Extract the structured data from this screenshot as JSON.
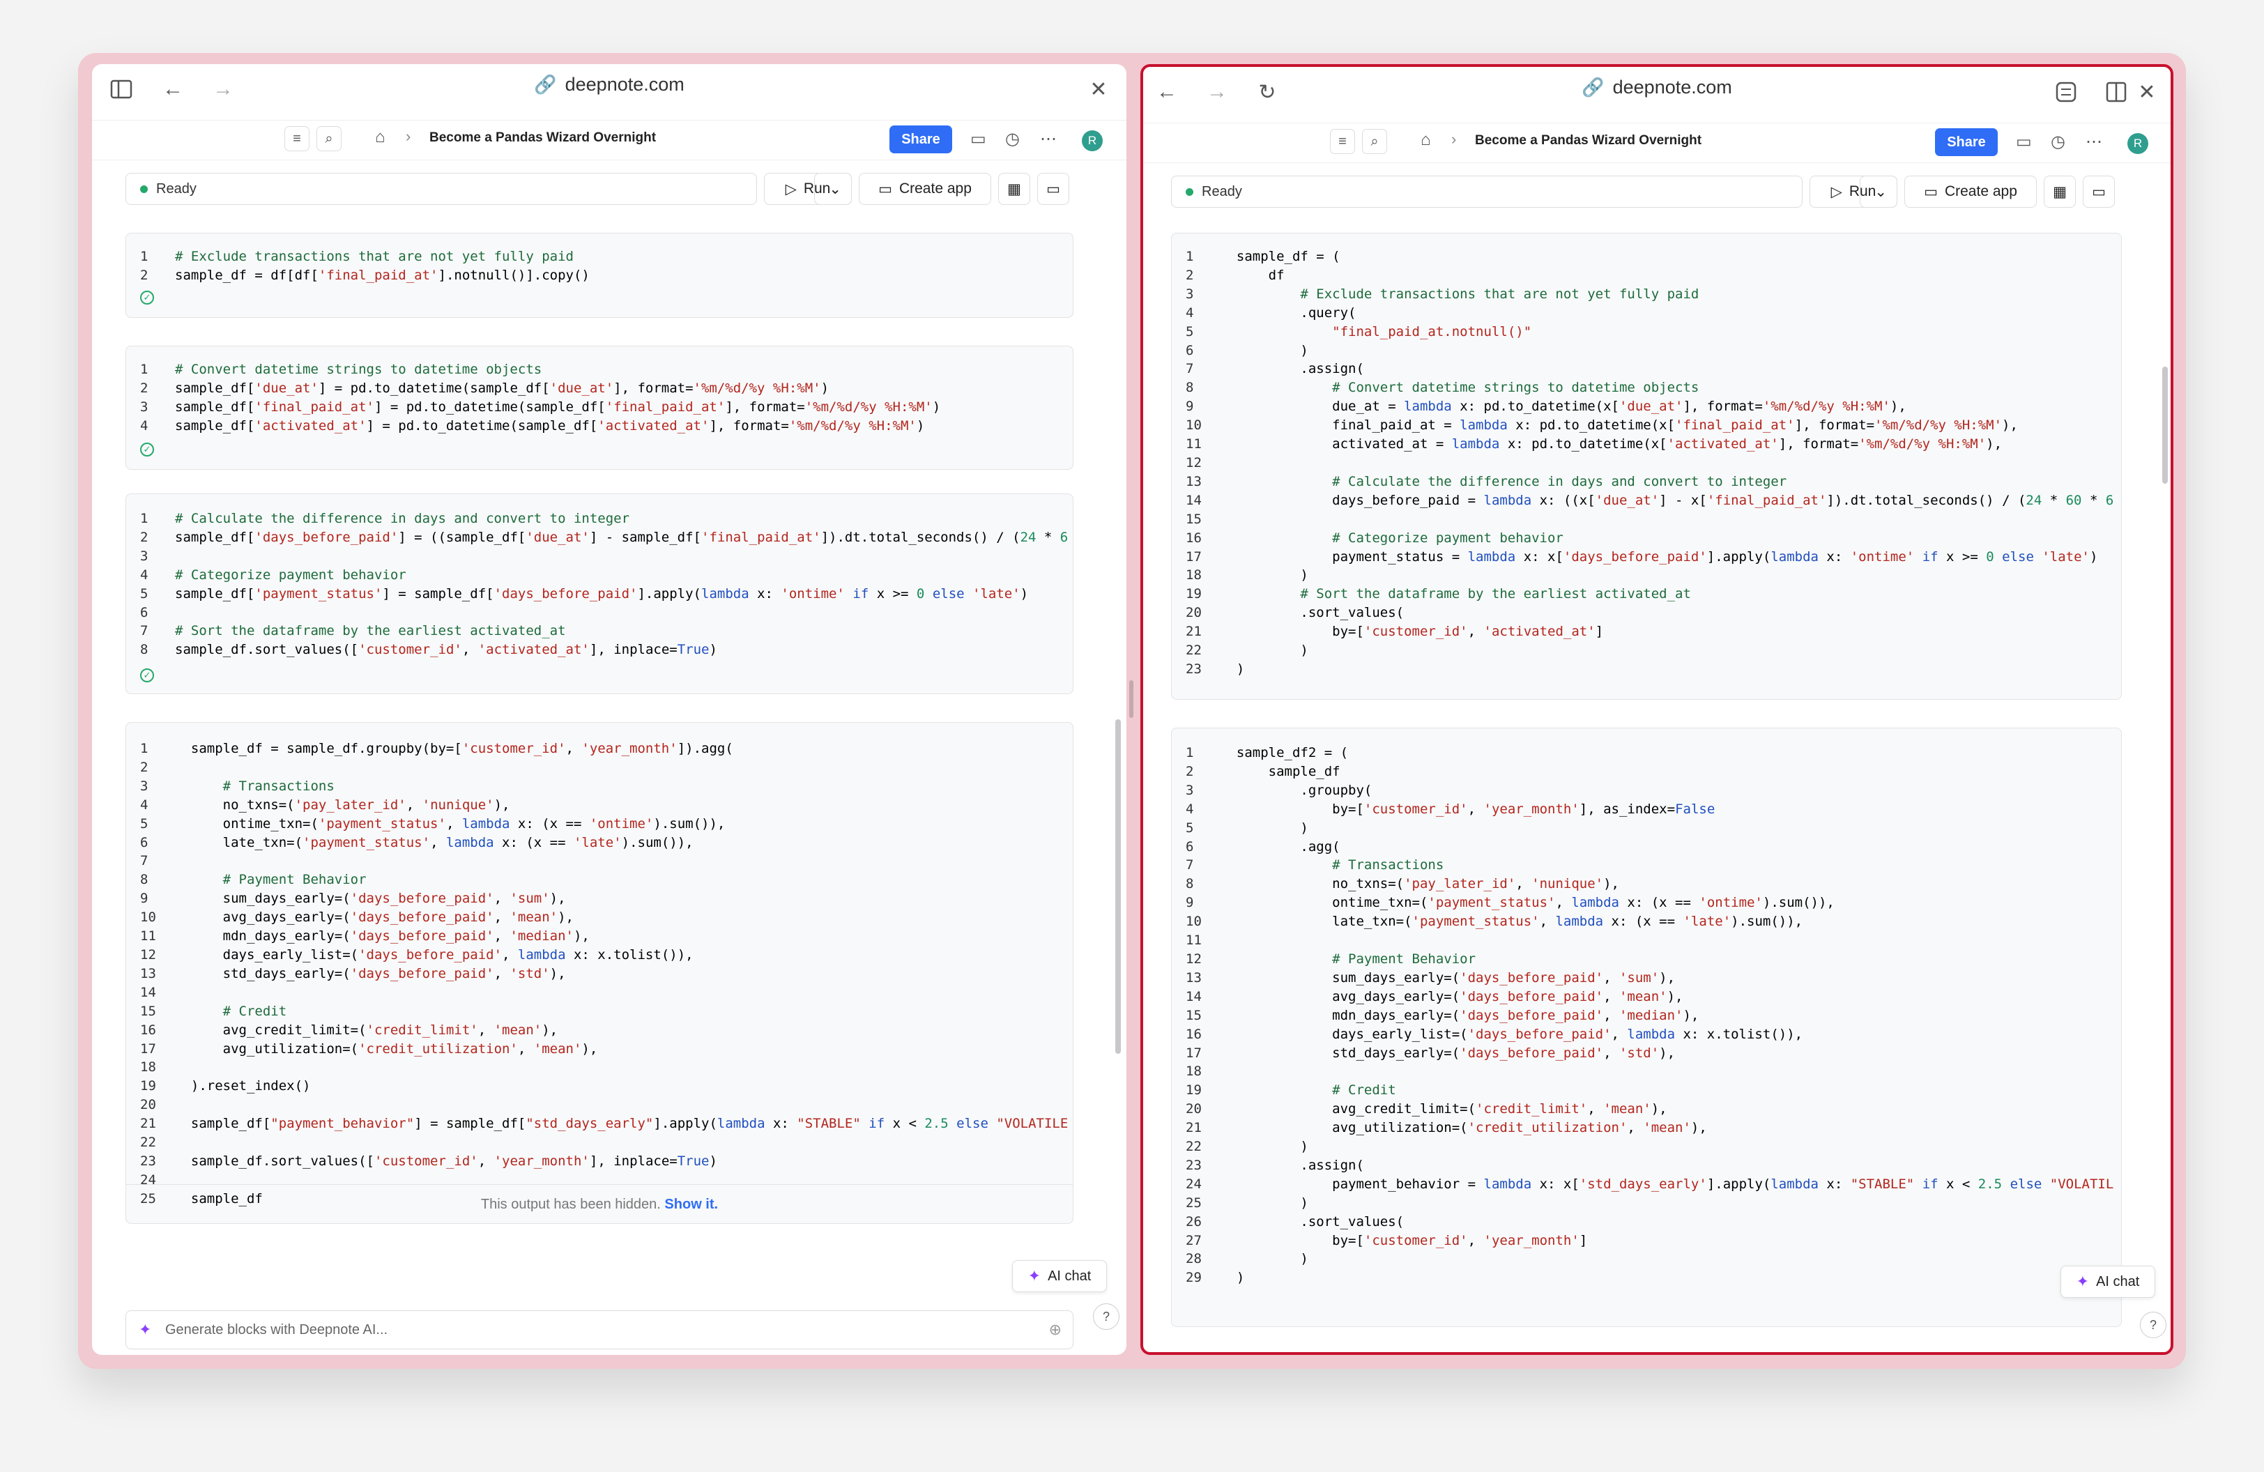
{
  "browser": {
    "url": "deepnote.com"
  },
  "notebook": {
    "title": "Become a Pandas Wizard Overnight",
    "share_label": "Share",
    "status": "Ready",
    "run_label": "Run",
    "create_app_label": "Create app",
    "avatar_initial": "R",
    "ai_chat_label": "AI chat",
    "generate_placeholder": "Generate blocks with Deepnote AI...",
    "hidden_output_text": "This output has been hidden.",
    "show_it_label": "Show it."
  },
  "colors": {
    "accent": "#2f6df6",
    "active_pane_border": "#c8102e",
    "success": "#25a86b"
  },
  "left_cells": [
    [
      "# Exclude transactions that are not yet fully paid",
      "sample_df = df[df['final_paid_at'].notnull()].copy()"
    ],
    [
      "# Convert datetime strings to datetime objects",
      "sample_df['due_at'] = pd.to_datetime(sample_df['due_at'], format='%m/%d/%y %H:%M')",
      "sample_df['final_paid_at'] = pd.to_datetime(sample_df['final_paid_at'], format='%m/%d/%y %H:%M')",
      "sample_df['activated_at'] = pd.to_datetime(sample_df['activated_at'], format='%m/%d/%y %H:%M')"
    ],
    [
      "# Calculate the difference in days and convert to integer",
      "sample_df['days_before_paid'] = ((sample_df['due_at'] - sample_df['final_paid_at']).dt.total_seconds() / (24 * 6",
      "",
      "# Categorize payment behavior",
      "sample_df['payment_status'] = sample_df['days_before_paid'].apply(lambda x: 'ontime' if x >= 0 else 'late')",
      "",
      "# Sort the dataframe by the earliest activated_at",
      "sample_df.sort_values(['customer_id', 'activated_at'], inplace=True)"
    ],
    [
      "  sample_df = sample_df.groupby(by=['customer_id', 'year_month']).agg(",
      "",
      "      # Transactions",
      "      no_txns=('pay_later_id', 'nunique'),",
      "      ontime_txn=('payment_status', lambda x: (x == 'ontime').sum()),",
      "      late_txn=('payment_status', lambda x: (x == 'late').sum()),",
      "",
      "      # Payment Behavior",
      "      sum_days_early=('days_before_paid', 'sum'),",
      "      avg_days_early=('days_before_paid', 'mean'),",
      "      mdn_days_early=('days_before_paid', 'median'),",
      "      days_early_list=('days_before_paid', lambda x: x.tolist()),",
      "      std_days_early=('days_before_paid', 'std'),",
      "",
      "      # Credit",
      "      avg_credit_limit=('credit_limit', 'mean'),",
      "      avg_utilization=('credit_utilization', 'mean'),",
      "",
      "  ).reset_index()",
      "",
      "  sample_df[\"payment_behavior\"] = sample_df[\"std_days_early\"].apply(lambda x: \"STABLE\" if x < 2.5 else \"VOLATILE",
      "",
      "  sample_df.sort_values(['customer_id', 'year_month'], inplace=True)",
      "",
      "  sample_df"
    ]
  ],
  "right_cells": [
    [
      "  sample_df = (",
      "      df",
      "          # Exclude transactions that are not yet fully paid",
      "          .query(",
      "              \"final_paid_at.notnull()\"",
      "          )",
      "          .assign(",
      "              # Convert datetime strings to datetime objects",
      "              due_at = lambda x: pd.to_datetime(x['due_at'], format='%m/%d/%y %H:%M'),",
      "              final_paid_at = lambda x: pd.to_datetime(x['final_paid_at'], format='%m/%d/%y %H:%M'),",
      "              activated_at = lambda x: pd.to_datetime(x['activated_at'], format='%m/%d/%y %H:%M'),",
      "",
      "              # Calculate the difference in days and convert to integer",
      "              days_before_paid = lambda x: ((x['due_at'] - x['final_paid_at']).dt.total_seconds() / (24 * 60 * 6",
      "",
      "              # Categorize payment behavior",
      "              payment_status = lambda x: x['days_before_paid'].apply(lambda x: 'ontime' if x >= 0 else 'late')",
      "          )",
      "          # Sort the dataframe by the earliest activated_at",
      "          .sort_values(",
      "              by=['customer_id', 'activated_at']",
      "          )",
      "  )"
    ],
    [
      "  sample_df2 = (",
      "      sample_df",
      "          .groupby(",
      "              by=['customer_id', 'year_month'], as_index=False",
      "          )",
      "          .agg(",
      "              # Transactions",
      "              no_txns=('pay_later_id', 'nunique'),",
      "              ontime_txn=('payment_status', lambda x: (x == 'ontime').sum()),",
      "              late_txn=('payment_status', lambda x: (x == 'late').sum()),",
      "",
      "              # Payment Behavior",
      "              sum_days_early=('days_before_paid', 'sum'),",
      "              avg_days_early=('days_before_paid', 'mean'),",
      "              mdn_days_early=('days_before_paid', 'median'),",
      "              days_early_list=('days_before_paid', lambda x: x.tolist()),",
      "              std_days_early=('days_before_paid', 'std'),",
      "",
      "              # Credit",
      "              avg_credit_limit=('credit_limit', 'mean'),",
      "              avg_utilization=('credit_utilization', 'mean'),",
      "          )",
      "          .assign(",
      "              payment_behavior = lambda x: x['std_days_early'].apply(lambda x: \"STABLE\" if x < 2.5 else \"VOLATIL",
      "          )",
      "          .sort_values(",
      "              by=['customer_id', 'year_month']",
      "          )",
      "  )"
    ]
  ]
}
